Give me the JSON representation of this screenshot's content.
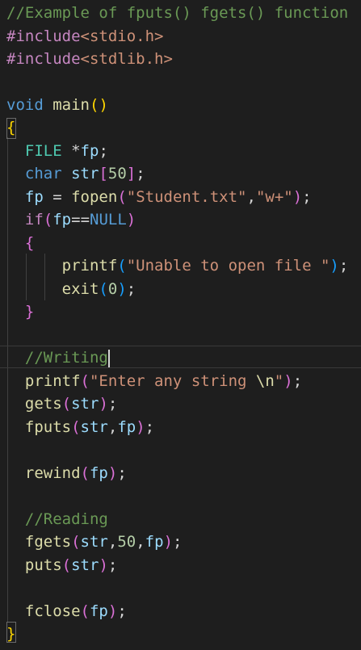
{
  "colors": {
    "background": "#1e1e1e",
    "comment": "#6a9955",
    "preprocessor": "#c586c0",
    "keyword": "#569cd6",
    "function": "#dcdcaa",
    "variable": "#9cdcfe",
    "string": "#ce9178",
    "number": "#b5cea8",
    "bracket_level1": "#ffd700",
    "bracket_level2": "#da70d6",
    "bracket_level3": "#179fff"
  },
  "code": {
    "l1": {
      "comment": "//Example of fputs() fgets() function"
    },
    "l2": {
      "directive": "#include",
      "header": "<stdio.h>"
    },
    "l3": {
      "directive": "#include",
      "header": "<stdlib.h>"
    },
    "l5": {
      "kw": "void",
      "fn": "main",
      "open": "(",
      "close": ")"
    },
    "l6": {
      "brace": "{"
    },
    "l8": {
      "type": "FILE",
      "rest": " *",
      "var": "fp",
      "semi": ";"
    },
    "l9": {
      "kw": "char",
      "var": "str",
      "open": "[",
      "num": "50",
      "close": "]",
      "semi": ";"
    },
    "l10": {
      "var": "fp",
      "eq": " = ",
      "fn": "fopen",
      "open": "(",
      "str1": "\"Student.txt\"",
      "comma": ",",
      "str2": "\"w+\"",
      "close": ")",
      "semi": ";"
    },
    "l11": {
      "kw": "if",
      "open": "(",
      "var": "fp",
      "op": "==",
      "const": "NULL",
      "close": ")"
    },
    "l12": {
      "brace": "{"
    },
    "l13": {
      "fn": "printf",
      "open": "(",
      "str": "\"Unable to open file \"",
      "close": ")",
      "semi": ";"
    },
    "l14": {
      "fn": "exit",
      "open": "(",
      "num": "0",
      "close": ")",
      "semi": ";"
    },
    "l15": {
      "brace": "}"
    },
    "l17": {
      "comment": "//Writing"
    },
    "l18": {
      "fn": "printf",
      "open": "(",
      "str1": "\"Enter any string ",
      "esc": "\\n",
      "str2": "\"",
      "close": ")",
      "semi": ";"
    },
    "l19": {
      "fn": "gets",
      "open": "(",
      "var": "str",
      "close": ")",
      "semi": ";"
    },
    "l20": {
      "fn": "fputs",
      "open": "(",
      "var1": "str",
      "comma": ",",
      "var2": "fp",
      "close": ")",
      "semi": ";"
    },
    "l22": {
      "fn": "rewind",
      "open": "(",
      "var": "fp",
      "close": ")",
      "semi": ";"
    },
    "l24": {
      "comment": "//Reading"
    },
    "l25": {
      "fn": "fgets",
      "open": "(",
      "var1": "str",
      "comma1": ",",
      "num": "50",
      "comma2": ",",
      "var2": "fp",
      "close": ")",
      "semi": ";"
    },
    "l26": {
      "fn": "puts",
      "open": "(",
      "var": "str",
      "close": ")",
      "semi": ";"
    },
    "l28": {
      "fn": "fclose",
      "open": "(",
      "var": "fp",
      "close": ")",
      "semi": ";"
    },
    "l29": {
      "brace": "}"
    }
  }
}
